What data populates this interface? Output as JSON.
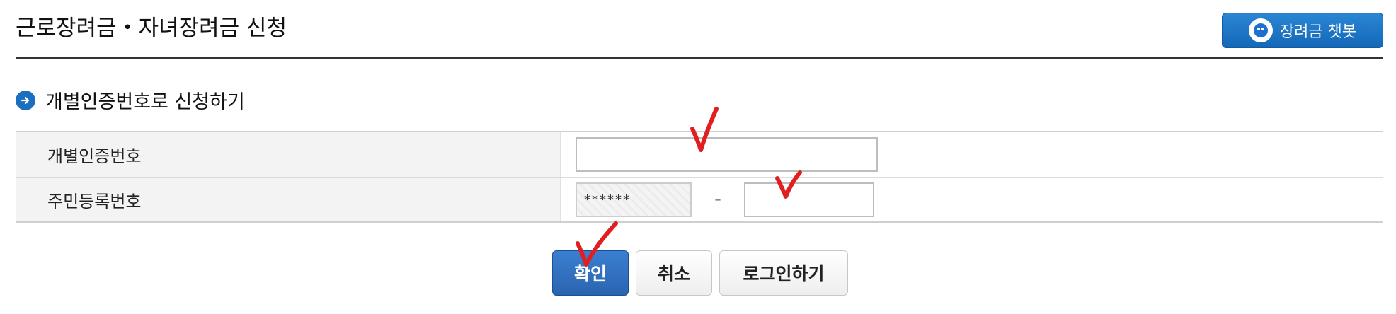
{
  "header": {
    "title": "근로장려금・자녀장려금 신청",
    "chatbot_label": "장려금 챗봇"
  },
  "section": {
    "title": "개별인증번호로 신청하기"
  },
  "form": {
    "auth_number_label": "개별인증번호",
    "auth_number_value": "",
    "rrn_label": "주민등록번호",
    "rrn_front_masked": "******",
    "rrn_separator": "–",
    "rrn_back_value": ""
  },
  "buttons": {
    "confirm": "확인",
    "cancel": "취소",
    "login": "로그인하기"
  },
  "colors": {
    "accent": "#2a64b0",
    "annotation": "#e02020"
  }
}
